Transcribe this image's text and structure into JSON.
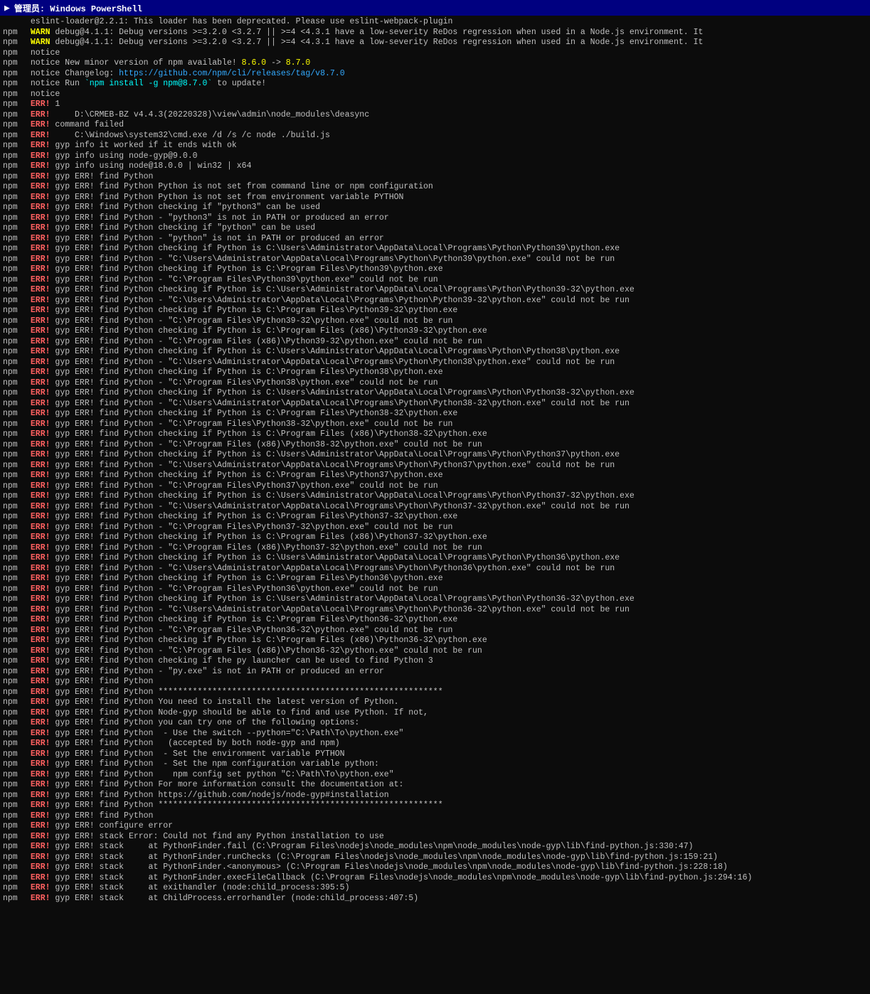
{
  "titleBar": {
    "icon": "powershell",
    "label": "管理员: Windows PowerShell"
  },
  "lines": [
    {
      "prefix": "",
      "type": "normal",
      "text": "eslint-loader@2.2.1: This loader has been deprecated. Please use eslint-webpack-plugin"
    },
    {
      "prefix": "npm",
      "type": "warn",
      "text": "debug@4.1.1: Debug versions >=3.2.0 <3.2.7 || >=4 <4.3.1 have a low-severity ReDos regression when used in a Node.js environment. It"
    },
    {
      "prefix": "npm",
      "type": "warn",
      "text": "debug@4.1.1: Debug versions >=3.2.0 <3.2.7 || >=4 <4.3.1 have a low-severity ReDos regression when used in a Node.js environment. It"
    },
    {
      "prefix": "npm",
      "type": "notice",
      "text": ""
    },
    {
      "prefix": "npm",
      "type": "notice",
      "text": "New minor version of npm available! 8.6.0 -> 8.7.0",
      "hasLink": true,
      "linkStart": 38,
      "linkText": "8.6.0 -> 8.7.0"
    },
    {
      "prefix": "npm",
      "type": "notice",
      "text": "Changelog: https://github.com/npm/cli/releases/tag/v8.7.0",
      "hasLink": true
    },
    {
      "prefix": "npm",
      "type": "notice",
      "text": "Run `npm install -g npm@8.7.0` to update!"
    },
    {
      "prefix": "npm",
      "type": "notice",
      "text": ""
    },
    {
      "prefix": "npm",
      "type": "err",
      "text": "1"
    },
    {
      "prefix": "npm",
      "type": "err",
      "text": "    D:\\CRMEB-BZ v4.4.3(20220328)\\view\\admin\\node_modules\\deasync"
    },
    {
      "prefix": "npm",
      "type": "err",
      "text": "command failed"
    },
    {
      "prefix": "npm",
      "type": "err",
      "text": "    C:\\Windows\\system32\\cmd.exe /d /s /c node ./build.js"
    },
    {
      "prefix": "npm",
      "type": "err",
      "text": "gyp info it worked if it ends with ok"
    },
    {
      "prefix": "npm",
      "type": "err",
      "text": "gyp info using node-gyp@9.0.0"
    },
    {
      "prefix": "npm",
      "type": "err",
      "text": "gyp info using node@18.0.0 | win32 | x64"
    },
    {
      "prefix": "npm",
      "type": "err",
      "text": "gyp ERR! find Python"
    },
    {
      "prefix": "npm",
      "type": "err",
      "text": "gyp ERR! find Python Python is not set from command line or npm configuration"
    },
    {
      "prefix": "npm",
      "type": "err",
      "text": "gyp ERR! find Python Python is not set from environment variable PYTHON"
    },
    {
      "prefix": "npm",
      "type": "err",
      "text": "gyp ERR! find Python checking if \"python3\" can be used"
    },
    {
      "prefix": "npm",
      "type": "err",
      "text": "gyp ERR! find Python - \"python3\" is not in PATH or produced an error"
    },
    {
      "prefix": "npm",
      "type": "err",
      "text": "gyp ERR! find Python checking if \"python\" can be used"
    },
    {
      "prefix": "npm",
      "type": "err",
      "text": "gyp ERR! find Python - \"python\" is not in PATH or produced an error"
    },
    {
      "prefix": "npm",
      "type": "err",
      "text": "gyp ERR! find Python checking if Python is C:\\Users\\Administrator\\AppData\\Local\\Programs\\Python\\Python39\\python.exe"
    },
    {
      "prefix": "npm",
      "type": "err",
      "text": "gyp ERR! find Python - \"C:\\Users\\Administrator\\AppData\\Local\\Programs\\Python\\Python39\\python.exe\" could not be run"
    },
    {
      "prefix": "npm",
      "type": "err",
      "text": "gyp ERR! find Python checking if Python is C:\\Program Files\\Python39\\python.exe"
    },
    {
      "prefix": "npm",
      "type": "err",
      "text": "gyp ERR! find Python - \"C:\\Program Files\\Python39\\python.exe\" could not be run"
    },
    {
      "prefix": "npm",
      "type": "err",
      "text": "gyp ERR! find Python checking if Python is C:\\Users\\Administrator\\AppData\\Local\\Programs\\Python\\Python39-32\\python.exe"
    },
    {
      "prefix": "npm",
      "type": "err",
      "text": "gyp ERR! find Python - \"C:\\Users\\Administrator\\AppData\\Local\\Programs\\Python\\Python39-32\\python.exe\" could not be run"
    },
    {
      "prefix": "npm",
      "type": "err",
      "text": "gyp ERR! find Python checking if Python is C:\\Program Files\\Python39-32\\python.exe"
    },
    {
      "prefix": "npm",
      "type": "err",
      "text": "gyp ERR! find Python - \"C:\\Program Files\\Python39-32\\python.exe\" could not be run"
    },
    {
      "prefix": "npm",
      "type": "err",
      "text": "gyp ERR! find Python checking if Python is C:\\Program Files (x86)\\Python39-32\\python.exe"
    },
    {
      "prefix": "npm",
      "type": "err",
      "text": "gyp ERR! find Python - \"C:\\Program Files (x86)\\Python39-32\\python.exe\" could not be run"
    },
    {
      "prefix": "npm",
      "type": "err",
      "text": "gyp ERR! find Python checking if Python is C:\\Users\\Administrator\\AppData\\Local\\Programs\\Python\\Python38\\python.exe"
    },
    {
      "prefix": "npm",
      "type": "err",
      "text": "gyp ERR! find Python - \"C:\\Users\\Administrator\\AppData\\Local\\Programs\\Python\\Python38\\python.exe\" could not be run"
    },
    {
      "prefix": "npm",
      "type": "err",
      "text": "gyp ERR! find Python checking if Python is C:\\Program Files\\Python38\\python.exe"
    },
    {
      "prefix": "npm",
      "type": "err",
      "text": "gyp ERR! find Python - \"C:\\Program Files\\Python38\\python.exe\" could not be run"
    },
    {
      "prefix": "npm",
      "type": "err",
      "text": "gyp ERR! find Python checking if Python is C:\\Users\\Administrator\\AppData\\Local\\Programs\\Python\\Python38-32\\python.exe"
    },
    {
      "prefix": "npm",
      "type": "err",
      "text": "gyp ERR! find Python - \"C:\\Users\\Administrator\\AppData\\Local\\Programs\\Python\\Python38-32\\python.exe\" could not be run"
    },
    {
      "prefix": "npm",
      "type": "err",
      "text": "gyp ERR! find Python checking if Python is C:\\Program Files\\Python38-32\\python.exe"
    },
    {
      "prefix": "npm",
      "type": "err",
      "text": "gyp ERR! find Python - \"C:\\Program Files\\Python38-32\\python.exe\" could not be run"
    },
    {
      "prefix": "npm",
      "type": "err",
      "text": "gyp ERR! find Python checking if Python is C:\\Program Files (x86)\\Python38-32\\python.exe"
    },
    {
      "prefix": "npm",
      "type": "err",
      "text": "gyp ERR! find Python - \"C:\\Program Files (x86)\\Python38-32\\python.exe\" could not be run"
    },
    {
      "prefix": "npm",
      "type": "err",
      "text": "gyp ERR! find Python checking if Python is C:\\Users\\Administrator\\AppData\\Local\\Programs\\Python\\Python37\\python.exe"
    },
    {
      "prefix": "npm",
      "type": "err",
      "text": "gyp ERR! find Python - \"C:\\Users\\Administrator\\AppData\\Local\\Programs\\Python\\Python37\\python.exe\" could not be run"
    },
    {
      "prefix": "npm",
      "type": "err",
      "text": "gyp ERR! find Python checking if Python is C:\\Program Files\\Python37\\python.exe"
    },
    {
      "prefix": "npm",
      "type": "err",
      "text": "gyp ERR! find Python - \"C:\\Program Files\\Python37\\python.exe\" could not be run"
    },
    {
      "prefix": "npm",
      "type": "err",
      "text": "gyp ERR! find Python checking if Python is C:\\Users\\Administrator\\AppData\\Local\\Programs\\Python\\Python37-32\\python.exe"
    },
    {
      "prefix": "npm",
      "type": "err",
      "text": "gyp ERR! find Python - \"C:\\Users\\Administrator\\AppData\\Local\\Programs\\Python\\Python37-32\\python.exe\" could not be run"
    },
    {
      "prefix": "npm",
      "type": "err",
      "text": "gyp ERR! find Python checking if Python is C:\\Program Files\\Python37-32\\python.exe"
    },
    {
      "prefix": "npm",
      "type": "err",
      "text": "gyp ERR! find Python - \"C:\\Program Files\\Python37-32\\python.exe\" could not be run"
    },
    {
      "prefix": "npm",
      "type": "err",
      "text": "gyp ERR! find Python checking if Python is C:\\Program Files (x86)\\Python37-32\\python.exe"
    },
    {
      "prefix": "npm",
      "type": "err",
      "text": "gyp ERR! find Python - \"C:\\Program Files (x86)\\Python37-32\\python.exe\" could not be run"
    },
    {
      "prefix": "npm",
      "type": "err",
      "text": "gyp ERR! find Python checking if Python is C:\\Users\\Administrator\\AppData\\Local\\Programs\\Python\\Python36\\python.exe"
    },
    {
      "prefix": "npm",
      "type": "err",
      "text": "gyp ERR! find Python - \"C:\\Users\\Administrator\\AppData\\Local\\Programs\\Python\\Python36\\python.exe\" could not be run"
    },
    {
      "prefix": "npm",
      "type": "err",
      "text": "gyp ERR! find Python checking if Python is C:\\Program Files\\Python36\\python.exe"
    },
    {
      "prefix": "npm",
      "type": "err",
      "text": "gyp ERR! find Python - \"C:\\Program Files\\Python36\\python.exe\" could not be run"
    },
    {
      "prefix": "npm",
      "type": "err",
      "text": "gyp ERR! find Python checking if Python is C:\\Users\\Administrator\\AppData\\Local\\Programs\\Python\\Python36-32\\python.exe"
    },
    {
      "prefix": "npm",
      "type": "err",
      "text": "gyp ERR! find Python - \"C:\\Users\\Administrator\\AppData\\Local\\Programs\\Python\\Python36-32\\python.exe\" could not be run"
    },
    {
      "prefix": "npm",
      "type": "err",
      "text": "gyp ERR! find Python checking if Python is C:\\Program Files\\Python36-32\\python.exe"
    },
    {
      "prefix": "npm",
      "type": "err",
      "text": "gyp ERR! find Python - \"C:\\Program Files\\Python36-32\\python.exe\" could not be run"
    },
    {
      "prefix": "npm",
      "type": "err",
      "text": "gyp ERR! find Python checking if Python is C:\\Program Files (x86)\\Python36-32\\python.exe"
    },
    {
      "prefix": "npm",
      "type": "err",
      "text": "gyp ERR! find Python - \"C:\\Program Files (x86)\\Python36-32\\python.exe\" could not be run"
    },
    {
      "prefix": "npm",
      "type": "err",
      "text": "gyp ERR! find Python checking if the py launcher can be used to find Python 3"
    },
    {
      "prefix": "npm",
      "type": "err",
      "text": "gyp ERR! find Python - \"py.exe\" is not in PATH or produced an error"
    },
    {
      "prefix": "npm",
      "type": "err",
      "text": "gyp ERR! find Python"
    },
    {
      "prefix": "npm",
      "type": "err",
      "text": "gyp ERR! find Python **********************************************************"
    },
    {
      "prefix": "npm",
      "type": "err",
      "text": "gyp ERR! find Python You need to install the latest version of Python."
    },
    {
      "prefix": "npm",
      "type": "err",
      "text": "gyp ERR! find Python Node-gyp should be able to find and use Python. If not,"
    },
    {
      "prefix": "npm",
      "type": "err",
      "text": "gyp ERR! find Python you can try one of the following options:"
    },
    {
      "prefix": "npm",
      "type": "err",
      "text": "gyp ERR! find Python  - Use the switch --python=\"C:\\Path\\To\\python.exe\""
    },
    {
      "prefix": "npm",
      "type": "err",
      "text": "gyp ERR! find Python   (accepted by both node-gyp and npm)"
    },
    {
      "prefix": "npm",
      "type": "err",
      "text": "gyp ERR! find Python  - Set the environment variable PYTHON"
    },
    {
      "prefix": "npm",
      "type": "err",
      "text": "gyp ERR! find Python  - Set the npm configuration variable python:"
    },
    {
      "prefix": "npm",
      "type": "err",
      "text": "gyp ERR! find Python    npm config set python \"C:\\Path\\To\\python.exe\""
    },
    {
      "prefix": "npm",
      "type": "err",
      "text": "gyp ERR! find Python For more information consult the documentation at:"
    },
    {
      "prefix": "npm",
      "type": "err",
      "text": "gyp ERR! find Python https://github.com/nodejs/node-gyp#installation"
    },
    {
      "prefix": "npm",
      "type": "err",
      "text": "gyp ERR! find Python **********************************************************"
    },
    {
      "prefix": "npm",
      "type": "err",
      "text": "gyp ERR! find Python"
    },
    {
      "prefix": "npm",
      "type": "err",
      "text": "gyp ERR! configure error"
    },
    {
      "prefix": "npm",
      "type": "err",
      "text": "gyp ERR! stack Error: Could not find any Python installation to use"
    },
    {
      "prefix": "npm",
      "type": "err",
      "text": "gyp ERR! stack     at PythonFinder.fail (C:\\Program Files\\nodejs\\node_modules\\npm\\node_modules\\node-gyp\\lib\\find-python.js:330:47)"
    },
    {
      "prefix": "npm",
      "type": "err",
      "text": "gyp ERR! stack     at PythonFinder.runChecks (C:\\Program Files\\nodejs\\node_modules\\npm\\node_modules\\node-gyp\\lib\\find-python.js:159:21)"
    },
    {
      "prefix": "npm",
      "type": "err",
      "text": "gyp ERR! stack     at PythonFinder.<anonymous> (C:\\Program Files\\nodejs\\node_modules\\npm\\node_modules\\node-gyp\\lib\\find-python.js:228:18)"
    },
    {
      "prefix": "npm",
      "type": "err",
      "text": "gyp ERR! stack     at PythonFinder.execFileCallback (C:\\Program Files\\nodejs\\node_modules\\npm\\node_modules\\node-gyp\\lib\\find-python.js:294:16)"
    },
    {
      "prefix": "npm",
      "type": "err",
      "text": "gyp ERR! stack     at exithandler (node:child_process:395:5)"
    },
    {
      "prefix": "npm",
      "type": "err",
      "text": "gyp ERR! stack     at ChildProcess.errorhandler (node:child_process:407:5)"
    }
  ]
}
